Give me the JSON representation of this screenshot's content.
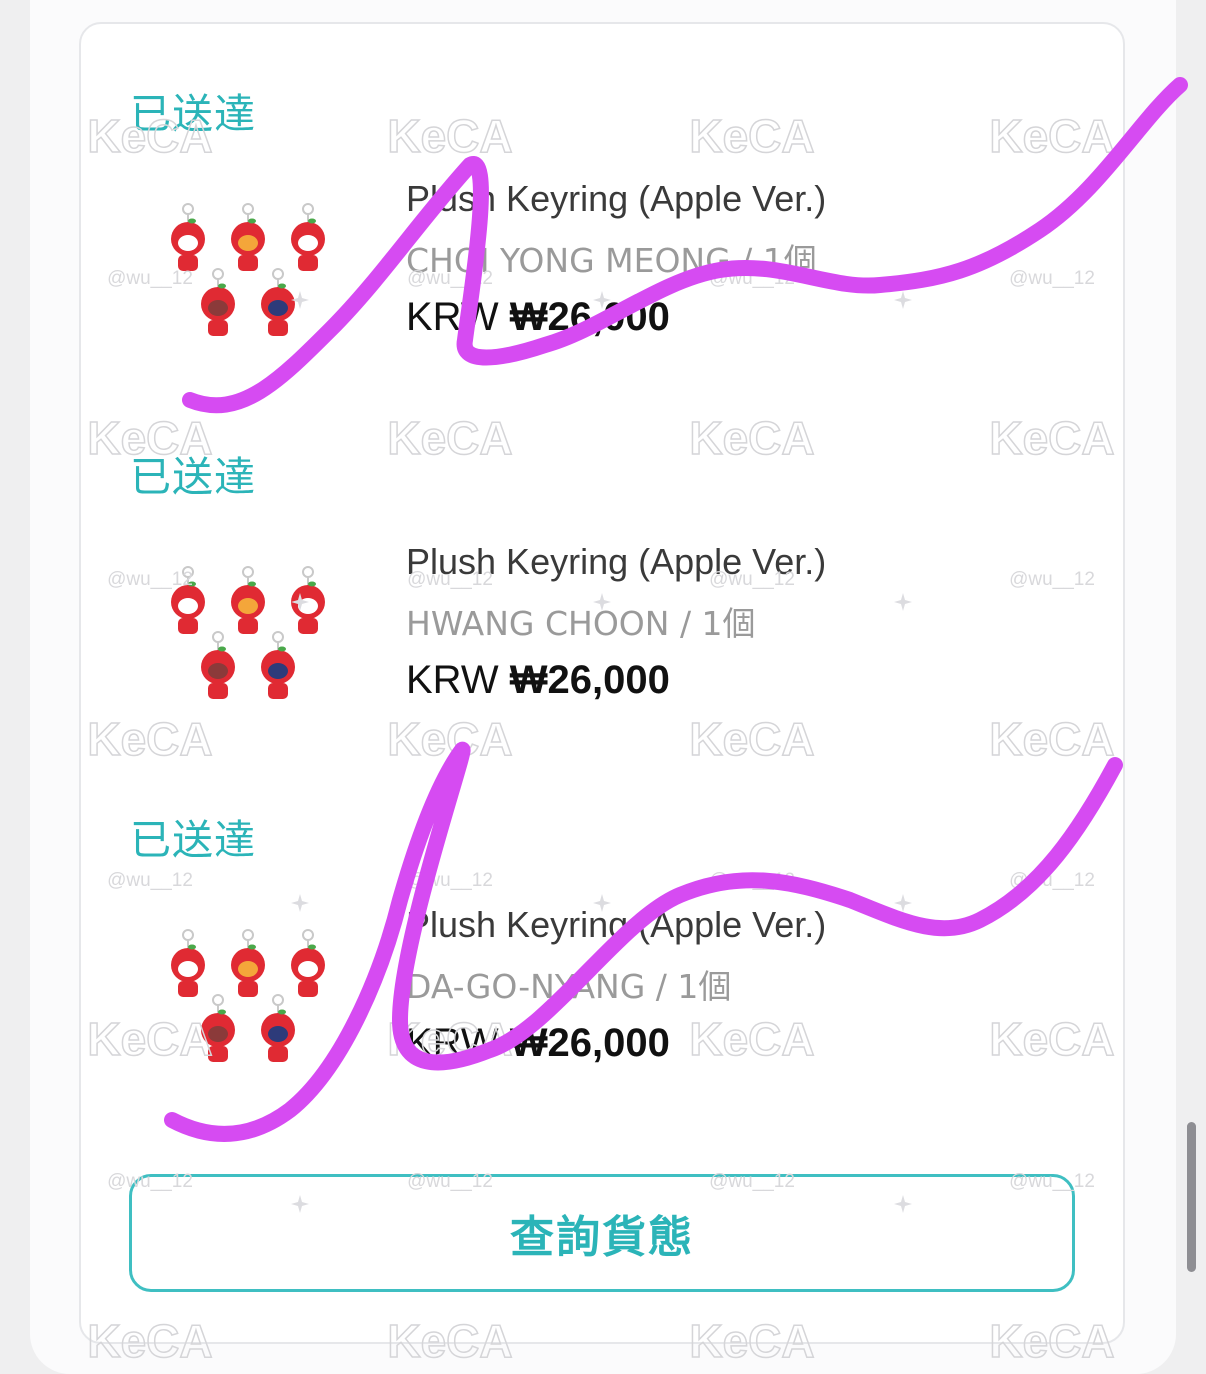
{
  "orders": [
    {
      "status": "已送達",
      "name": "Plush Keyring (Apple Ver.)",
      "option": "CHOI YONG MEONG / 1個",
      "currency": "KRW",
      "price": "₩26,000",
      "image_icon": "plush-keyring-apple-icon"
    },
    {
      "status": "已送達",
      "name": "Plush Keyring (Apple Ver.)",
      "option": "HWANG CHOON / 1個",
      "currency": "KRW",
      "price": "₩26,000",
      "image_icon": "plush-keyring-apple-icon"
    },
    {
      "status": "已送達",
      "name": "Plush Keyring (Apple Ver.)",
      "option": "DA-GO-NYANG / 1個",
      "currency": "KRW",
      "price": "₩26,000",
      "image_icon": "plush-keyring-apple-icon"
    }
  ],
  "track_button": "查詢貨態",
  "watermark": {
    "logo": "KeCA",
    "handle": "@wu__12"
  },
  "colors": {
    "accent": "#2bb4b8",
    "button_border": "#3fbfc2",
    "scribble": "#d64bf2",
    "plush_red": "#e02a33"
  }
}
